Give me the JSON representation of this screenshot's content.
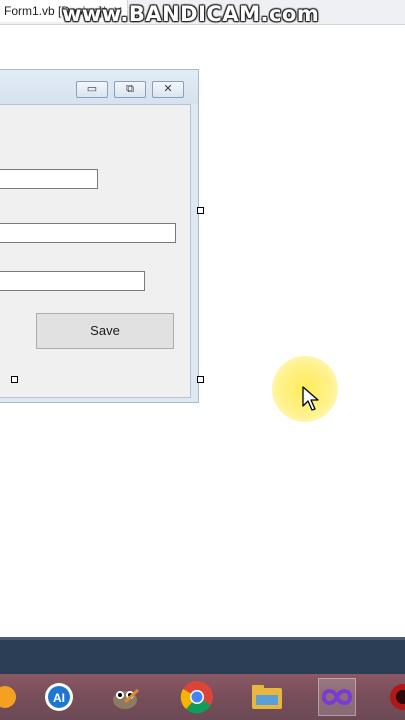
{
  "document_tab": {
    "title": "Form1.vb [Design]*",
    "close_glyph": "✕"
  },
  "watermark": {
    "text": "www.BANDICAM.com"
  },
  "form": {
    "title_buttons": {
      "minimize": "▭",
      "maximize": "⧉",
      "close": "✕"
    },
    "textboxes": [
      {
        "name": "textbox-1",
        "value": ""
      },
      {
        "name": "textbox-2",
        "value": ""
      },
      {
        "name": "textbox-3",
        "value": ""
      }
    ],
    "save_label": "Save"
  },
  "taskbar": {
    "icons": [
      "app-icon-partial",
      "paint-3d-icon",
      "gimp-icon",
      "chrome-icon",
      "file-explorer-icon",
      "visual-studio-icon",
      "bandicam-icon"
    ]
  }
}
